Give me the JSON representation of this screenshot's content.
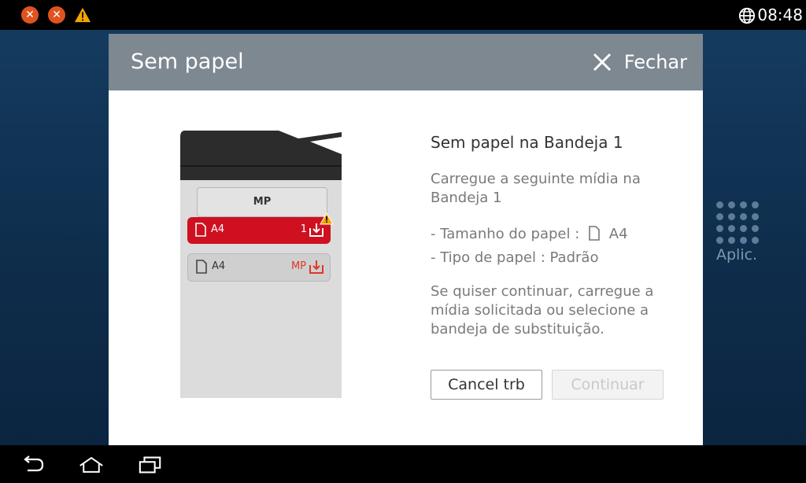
{
  "statusbar": {
    "time": "08:48",
    "icons": [
      "error-icon",
      "error-icon",
      "warning-icon",
      "globe-icon"
    ]
  },
  "dialog": {
    "title": "Sem papel",
    "close_label": "Fechar",
    "message_title": "Sem papel na Bandeja 1",
    "instruction": "Carregue a seguinte mídia na Bandeja 1",
    "paper_size_label": "- Tamanho do papel :",
    "paper_size_value": "A4",
    "paper_type": "- Tipo de papel : Padrão",
    "continue_info": "Se quiser continuar, carregue a mídia solicitada ou selecione a bandeja de substituição.",
    "cancel_button": "Cancel trb",
    "continue_button": "Continuar"
  },
  "printer": {
    "mp_label": "MP",
    "tray1": {
      "size": "A4",
      "number": "1",
      "status": "error"
    },
    "tray2": {
      "size": "A4",
      "number": "MP"
    }
  },
  "apps_label": "Aplic.",
  "colors": {
    "header": "#7d8891",
    "tray_error": "#cf1020",
    "accent_orange": "#e0531f"
  }
}
